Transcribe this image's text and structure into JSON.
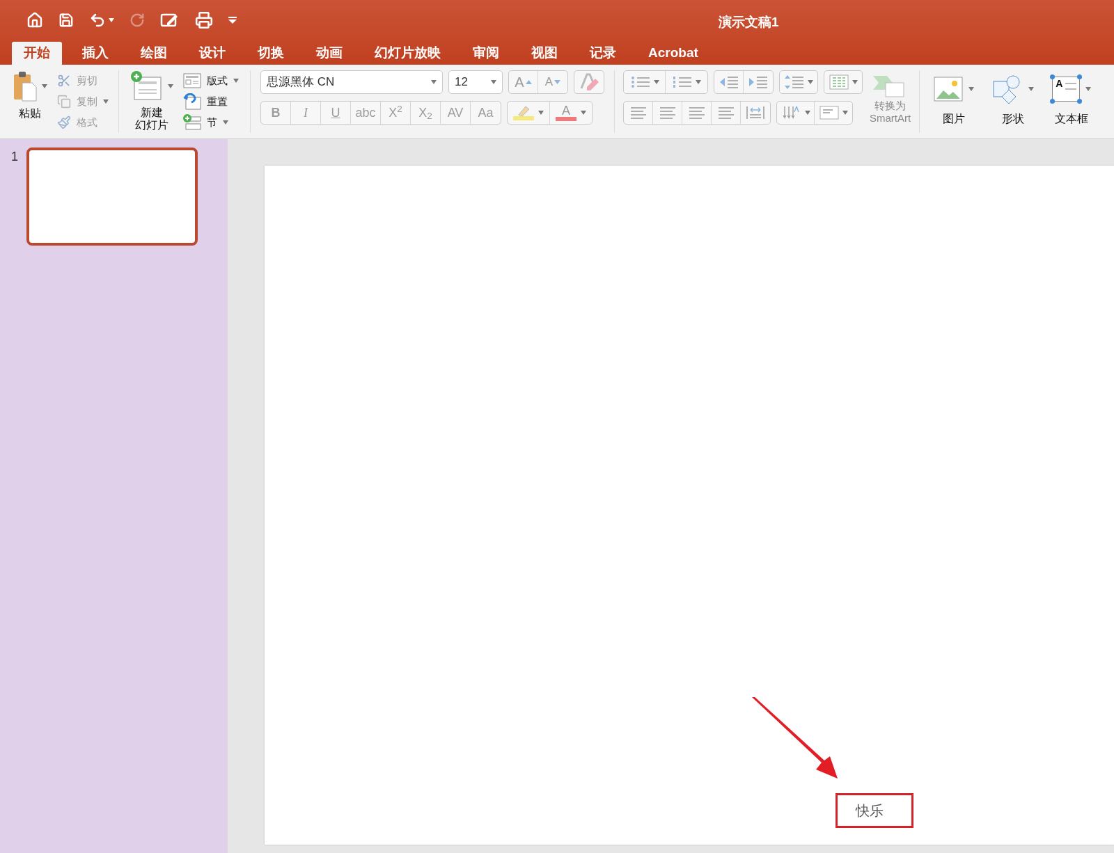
{
  "window": {
    "title": "演示文稿1"
  },
  "tabs": [
    {
      "label": "开始",
      "selected": true
    },
    {
      "label": "插入",
      "selected": false
    },
    {
      "label": "绘图",
      "selected": false
    },
    {
      "label": "设计",
      "selected": false
    },
    {
      "label": "切换",
      "selected": false
    },
    {
      "label": "动画",
      "selected": false
    },
    {
      "label": "幻灯片放映",
      "selected": false
    },
    {
      "label": "审阅",
      "selected": false
    },
    {
      "label": "视图",
      "selected": false
    },
    {
      "label": "记录",
      "selected": false
    },
    {
      "label": "Acrobat",
      "selected": false
    }
  ],
  "clipboard": {
    "paste": "粘贴",
    "items": [
      {
        "kind": "cut",
        "label": "剪切",
        "disabled": true
      },
      {
        "kind": "copy",
        "label": "复制",
        "disabled": true
      },
      {
        "kind": "format",
        "label": "格式",
        "disabled": true
      }
    ]
  },
  "slides_group": {
    "new_slide": [
      "新建",
      "幻灯片"
    ],
    "items": [
      {
        "kind": "layout",
        "label": "版式"
      },
      {
        "kind": "reset",
        "label": "重置"
      },
      {
        "kind": "section",
        "label": "节"
      }
    ]
  },
  "font": {
    "name": "思源黑体 CN",
    "size": "12",
    "grow": "A",
    "shrink": "A"
  },
  "format_buttons": [
    "B",
    "I",
    "U",
    "abc",
    "X$^{2}$",
    "X$_{2}$",
    "AV",
    "Aa"
  ],
  "color_buttons": [
    {
      "kind": "highlight",
      "color": "#f4e97a"
    },
    {
      "kind": "font",
      "label": "A",
      "color": "#ee7b7b"
    }
  ],
  "smartart": {
    "label": [
      "转换为",
      "SmartArt"
    ],
    "disabled": true
  },
  "insert": [
    {
      "kind": "picture",
      "label": "图片"
    },
    {
      "kind": "shape",
      "label": "形状"
    },
    {
      "kind": "textbox",
      "label": "文本框",
      "icon_text": "A"
    }
  ],
  "slide_panel": {
    "slides": [
      {
        "number": "1",
        "selected": true
      }
    ]
  },
  "slide": {
    "text": "快乐"
  }
}
